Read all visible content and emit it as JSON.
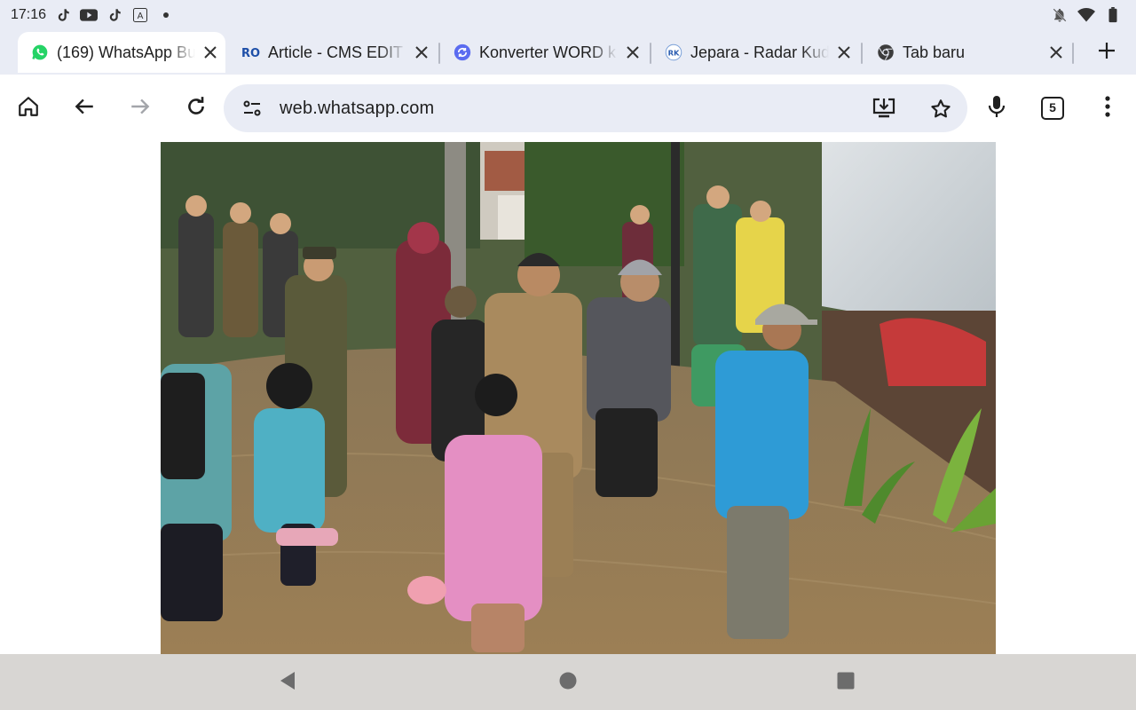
{
  "status_bar": {
    "time": "17:16",
    "left_icons": [
      "tiktok-icon",
      "youtube-icon",
      "tiktok-icon",
      "text-a-icon",
      "dot-icon"
    ],
    "right_icons": [
      "notifications-off-icon",
      "wifi-icon",
      "battery-icon"
    ]
  },
  "tabs": [
    {
      "title": "(169) WhatsApp Bu",
      "favicon": "whatsapp-icon",
      "active": true
    },
    {
      "title": "Article - CMS EDIT",
      "favicon": "ro-logo-icon",
      "active": false
    },
    {
      "title": "Konverter WORD k",
      "favicon": "converter-icon",
      "active": false
    },
    {
      "title": "Jepara - Radar Kud",
      "favicon": "rk-logo-icon",
      "active": false
    },
    {
      "title": "Tab baru",
      "favicon": "chrome-icon",
      "active": false
    }
  ],
  "toolbar": {
    "url": "web.whatsapp.com",
    "tab_count": "5"
  },
  "content": {
    "image_description_name": "flood-photo"
  },
  "colors": {
    "chrome_bg": "#e9ecf5",
    "toolbar_bg": "#ffffff",
    "nav_bg": "#d8d6d3",
    "whatsapp_green": "#25d366",
    "icon_dark": "#1f1f1f"
  }
}
